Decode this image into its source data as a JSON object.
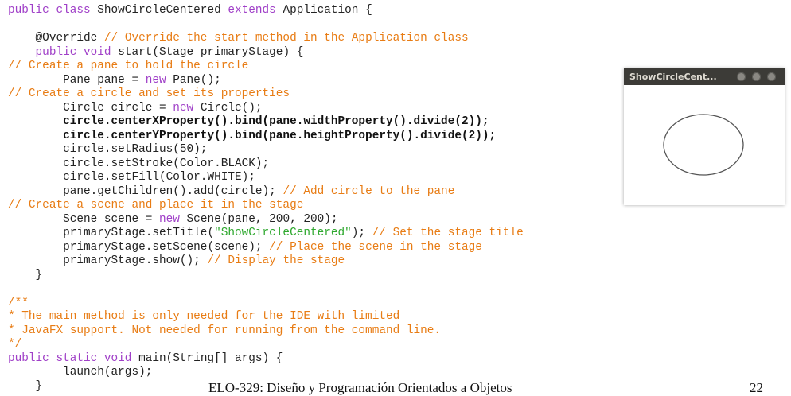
{
  "code_lines": [
    [
      {
        "t": "public class ",
        "c": "kw"
      },
      {
        "t": "ShowCircleCentered ",
        "c": ""
      },
      {
        "t": "extends ",
        "c": "kw"
      },
      {
        "t": "Application {",
        "c": ""
      }
    ],
    [],
    [
      {
        "t": "    @Override ",
        "c": ""
      },
      {
        "t": "// Override the start method in the Application class",
        "c": "cm"
      }
    ],
    [
      {
        "t": "    ",
        "c": ""
      },
      {
        "t": "public void ",
        "c": "kw"
      },
      {
        "t": "start(Stage primaryStage) {",
        "c": ""
      }
    ],
    [
      {
        "t": "// Create a pane to hold the circle",
        "c": "cm"
      }
    ],
    [
      {
        "t": "        Pane pane = ",
        "c": ""
      },
      {
        "t": "new ",
        "c": "kw"
      },
      {
        "t": "Pane();",
        "c": ""
      }
    ],
    [
      {
        "t": "// Create a circle and set its properties",
        "c": "cm"
      }
    ],
    [
      {
        "t": "        Circle circle = ",
        "c": ""
      },
      {
        "t": "new ",
        "c": "kw"
      },
      {
        "t": "Circle();",
        "c": ""
      }
    ],
    [
      {
        "t": "        circle.centerXProperty().bind(pane.widthProperty().divide(2));",
        "c": "b"
      }
    ],
    [
      {
        "t": "        circle.centerYProperty().bind(pane.heightProperty().divide(2));",
        "c": "b"
      }
    ],
    [
      {
        "t": "        circle.setRadius(50);",
        "c": ""
      }
    ],
    [
      {
        "t": "        circle.setStroke(Color.BLACK);",
        "c": ""
      }
    ],
    [
      {
        "t": "        circle.setFill(Color.WHITE);",
        "c": ""
      }
    ],
    [
      {
        "t": "        pane.getChildren().add(circle); ",
        "c": ""
      },
      {
        "t": "// Add circle to the pane",
        "c": "cm"
      }
    ],
    [
      {
        "t": "// Create a scene and place it in the stage",
        "c": "cm"
      }
    ],
    [
      {
        "t": "        Scene scene = ",
        "c": ""
      },
      {
        "t": "new ",
        "c": "kw"
      },
      {
        "t": "Scene(pane, 200, 200);",
        "c": ""
      }
    ],
    [
      {
        "t": "        primaryStage.setTitle(",
        "c": ""
      },
      {
        "t": "\"ShowCircleCentered\"",
        "c": "str"
      },
      {
        "t": "); ",
        "c": ""
      },
      {
        "t": "// Set the stage title",
        "c": "cm"
      }
    ],
    [
      {
        "t": "        primaryStage.setScene(scene); ",
        "c": ""
      },
      {
        "t": "// Place the scene in the stage",
        "c": "cm"
      }
    ],
    [
      {
        "t": "        primaryStage.show(); ",
        "c": ""
      },
      {
        "t": "// Display the stage",
        "c": "cm"
      }
    ],
    [
      {
        "t": "    }",
        "c": ""
      }
    ],
    [],
    [
      {
        "t": "/**",
        "c": "cm"
      }
    ],
    [
      {
        "t": "* The main method is only needed for the IDE with limited",
        "c": "cm"
      }
    ],
    [
      {
        "t": "* JavaFX support. Not needed for running from the command line.",
        "c": "cm"
      }
    ],
    [
      {
        "t": "*/",
        "c": "cm"
      }
    ],
    [
      {
        "t": "public static void ",
        "c": "kw"
      },
      {
        "t": "main(String[] args) {",
        "c": ""
      }
    ],
    [
      {
        "t": "        launch(args);",
        "c": ""
      }
    ],
    [
      {
        "t": "    }",
        "c": ""
      }
    ]
  ],
  "window": {
    "title": "ShowCircleCent...",
    "circle_stroke": "#555555"
  },
  "footer": {
    "course": "ELO-329: Diseño y Programación Orientados a Objetos",
    "page": "22"
  },
  "colors": {
    "keyword": "#a040c8",
    "comment": "#e87c14",
    "string": "#2ea82e",
    "titlebar": "#3c3b37"
  }
}
